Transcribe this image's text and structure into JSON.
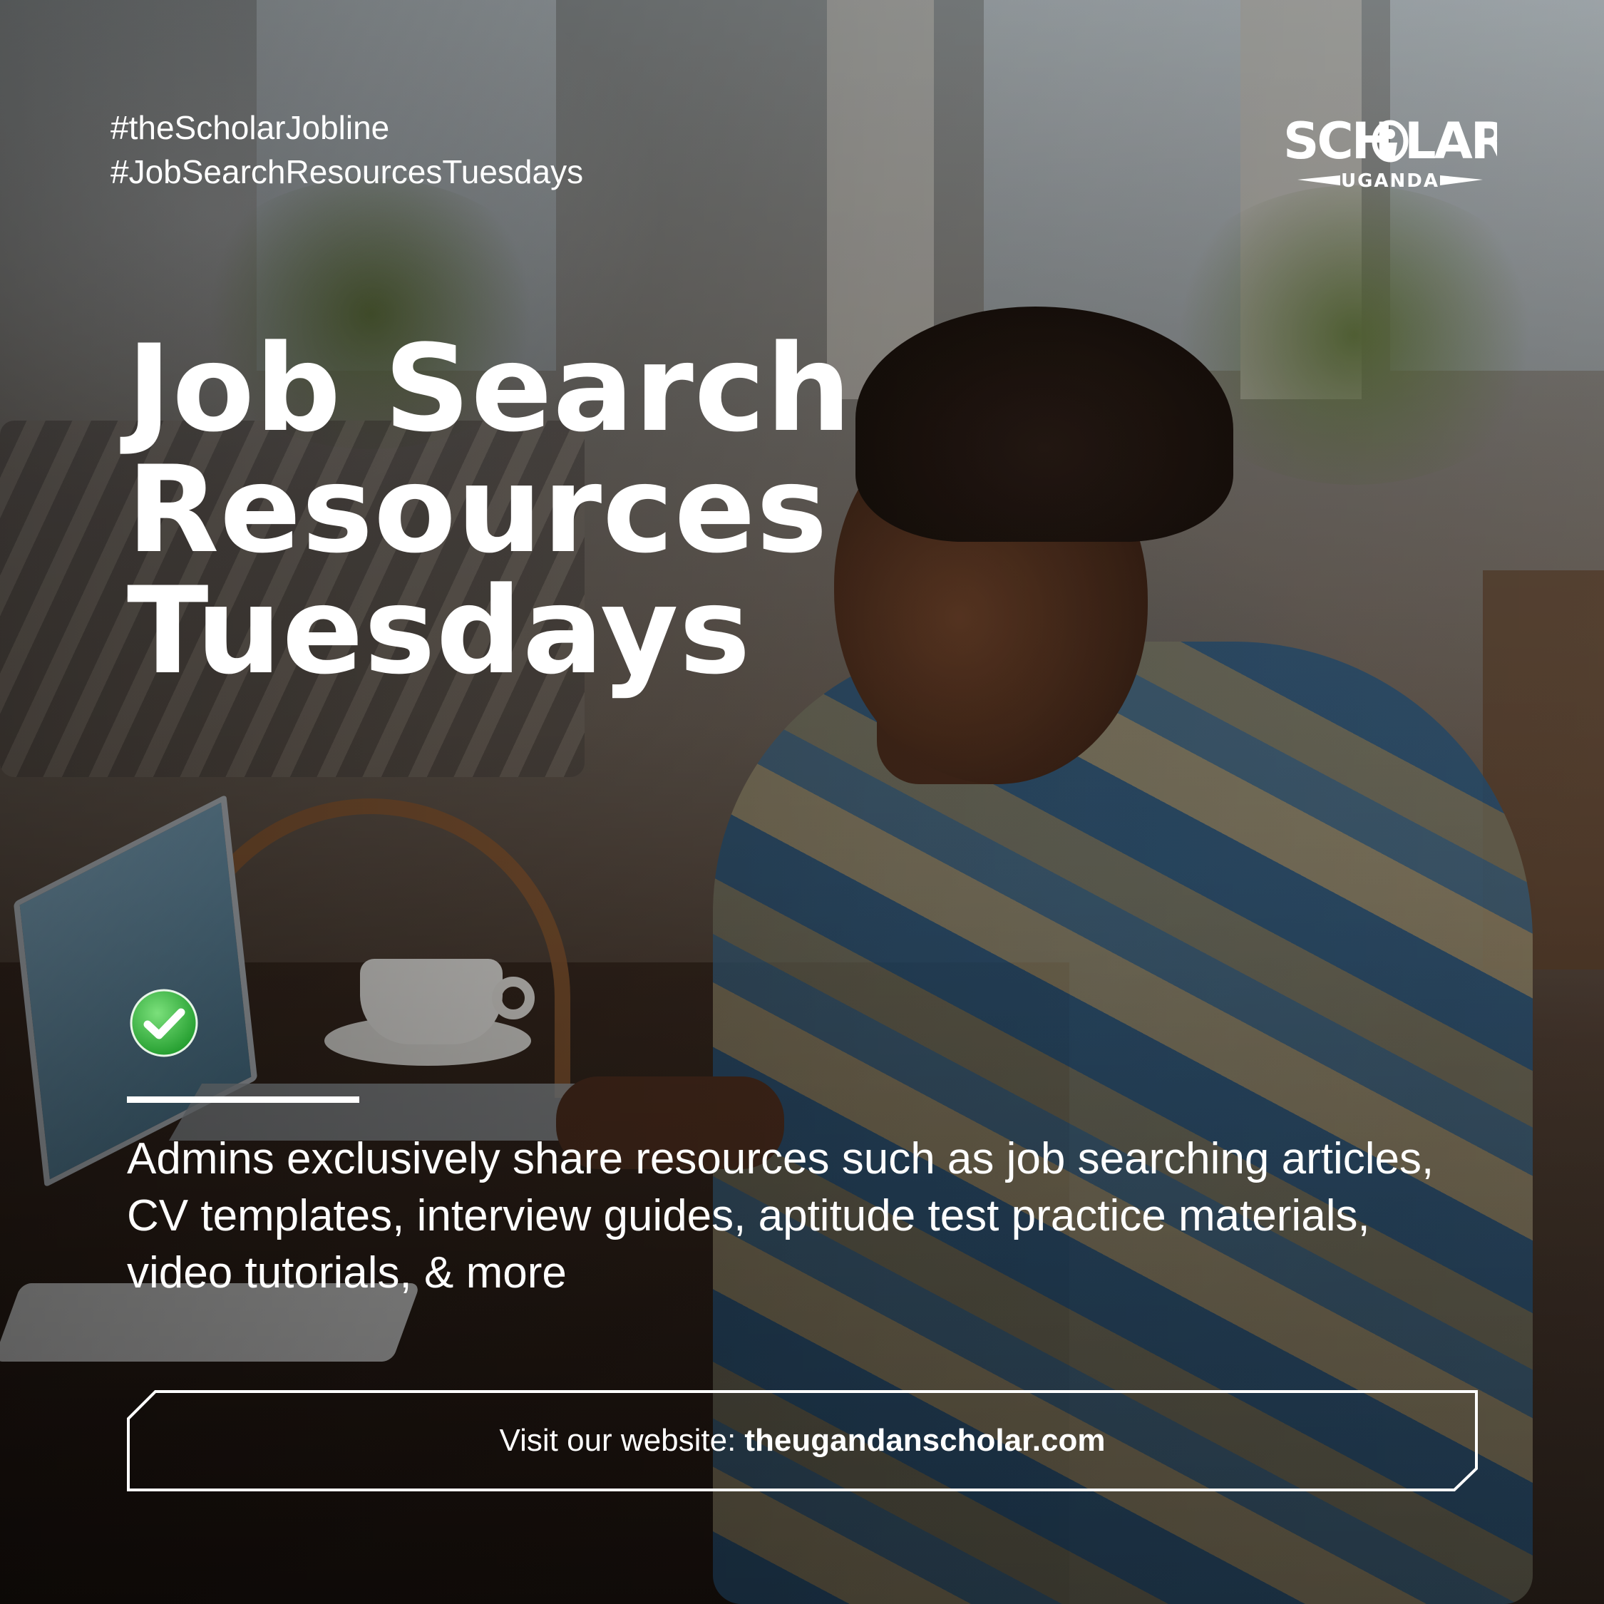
{
  "hashtags": [
    "#theScholarJobline",
    "#JobSearchResourcesTuesdays"
  ],
  "logo": {
    "top": "SCH",
    "top_end": "LAR",
    "bottom": "UGANDA",
    "icon": "scholar-figure-icon"
  },
  "headline": [
    "Job Search",
    "Resources",
    "Tuesdays"
  ],
  "check_icon": "check-circle-icon",
  "description": "Admins exclusively share resources such as job searching articles, CV templates, interview guides, aptitude test practice materials, video tutorials, & more",
  "cta": {
    "prefix": "Visit our website:",
    "url": "theugandanscholar.com"
  },
  "colors": {
    "text": "#ffffff",
    "check_green": "#3dbb3d"
  }
}
